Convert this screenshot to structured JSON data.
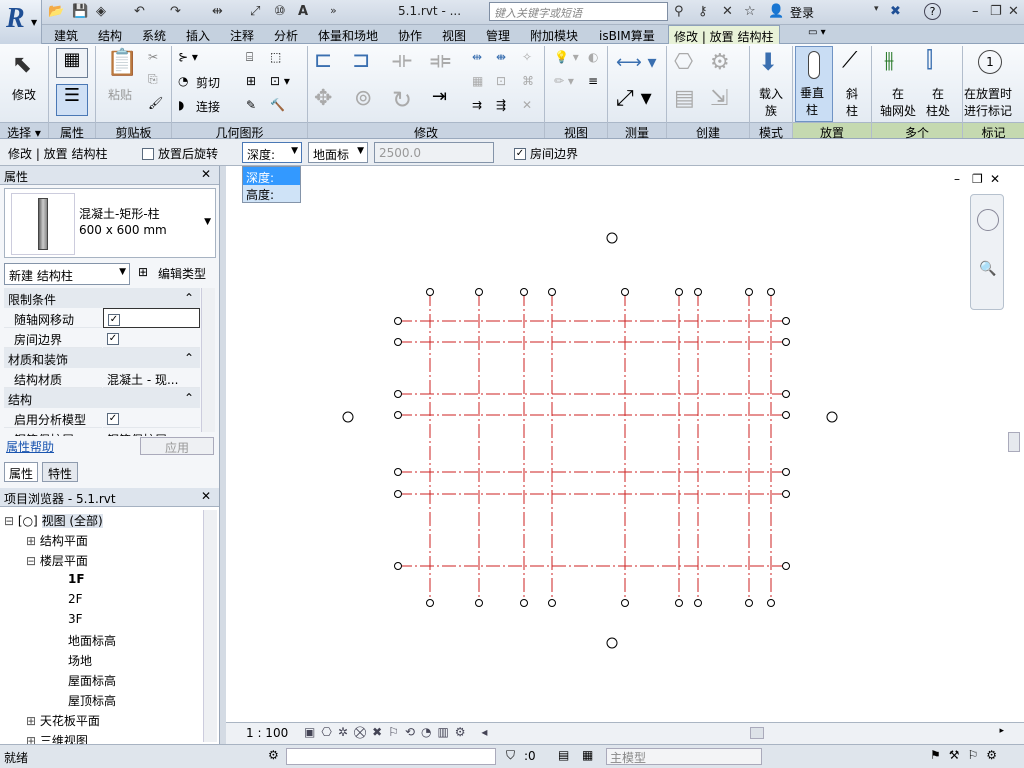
{
  "titlebar": {
    "title": "5.1.rvt - ...",
    "search_placeholder": "键入关键字或短语",
    "login": "登录",
    "help": "?"
  },
  "tabs": [
    "建筑",
    "结构",
    "系统",
    "插入",
    "注释",
    "分析",
    "体量和场地",
    "协作",
    "视图",
    "管理",
    "附加模块",
    "isBIM算量",
    "修改 | 放置 结构柱"
  ],
  "ribbon": {
    "modify_label": "修改",
    "select_label": "选择",
    "properties_label": "属性",
    "clipboard_label": "剪贴板",
    "paste_label": "粘贴",
    "geometry_label": "几何图形",
    "cut_label": "剪切",
    "join_label": "连接",
    "modify_group_label": "修改",
    "view_label": "视图",
    "measure_label": "测量",
    "create_label": "创建",
    "mode_label": "模式",
    "load_family": [
      "载入",
      "族"
    ],
    "vertical_column": [
      "垂直",
      "柱"
    ],
    "slanted_column": [
      "斜",
      "柱"
    ],
    "place_label": "放置",
    "at_grids": [
      "在",
      "轴网处"
    ],
    "at_columns": [
      "在",
      "柱处"
    ],
    "multiple_label": "多个",
    "tag_on_place": [
      "在放置时",
      "进行标记"
    ],
    "tag_label": "标记"
  },
  "options": {
    "context": "修改 | 放置 结构柱",
    "rotate_after": "放置后旋转",
    "depth_select": "深度:",
    "level_select": "地面标",
    "offset_value": "2500.0",
    "room_bounding": "房间边界",
    "dropdown_options": [
      "深度:",
      "高度:"
    ]
  },
  "properties": {
    "title": "属性",
    "type_name": "混凝土-矩形-柱",
    "type_size": "600 x 600 mm",
    "new_select": "新建 结构柱",
    "edit_type": "编辑类型",
    "sections": [
      {
        "name": "限制条件",
        "rows": [
          {
            "k": "随轴网移动",
            "v": "✓"
          },
          {
            "k": "房间边界",
            "v": "✓"
          }
        ]
      },
      {
        "name": "材质和装饰",
        "rows": [
          {
            "k": "结构材质",
            "v": "混凝土 - 现..."
          }
        ]
      },
      {
        "name": "结构",
        "rows": [
          {
            "k": "启用分析模型",
            "v": "✓"
          },
          {
            "k": "钢筋保护层 ...",
            "v": "钢筋保护层..."
          }
        ]
      }
    ],
    "help_link": "属性帮助",
    "apply": "应用",
    "tab_properties": "属性",
    "tab_features": "特性"
  },
  "browser": {
    "title": "项目浏览器 - 5.1.rvt",
    "items": [
      {
        "label": "视图 (全部)",
        "level": 0,
        "exp": "⊟"
      },
      {
        "label": "结构平面",
        "level": 1,
        "exp": "⊞"
      },
      {
        "label": "楼层平面",
        "level": 1,
        "exp": "⊟"
      },
      {
        "label": "1F",
        "level": 2,
        "exp": ""
      },
      {
        "label": "2F",
        "level": 2,
        "exp": ""
      },
      {
        "label": "3F",
        "level": 2,
        "exp": ""
      },
      {
        "label": "地面标高",
        "level": 2,
        "exp": ""
      },
      {
        "label": "场地",
        "level": 2,
        "exp": ""
      },
      {
        "label": "屋面标高",
        "level": 2,
        "exp": ""
      },
      {
        "label": "屋顶标高",
        "level": 2,
        "exp": ""
      },
      {
        "label": "天花板平面",
        "level": 1,
        "exp": "⊞"
      },
      {
        "label": "三维视图",
        "level": 1,
        "exp": "⊞"
      }
    ]
  },
  "viewbar": {
    "scale": "1 : 100"
  },
  "status": {
    "ready": "就绪",
    "count": ":0",
    "model": "主模型"
  },
  "colors": {
    "grid": "#cc2222",
    "accent": "#1f4f95",
    "tab_active": "#e8f2d8"
  }
}
